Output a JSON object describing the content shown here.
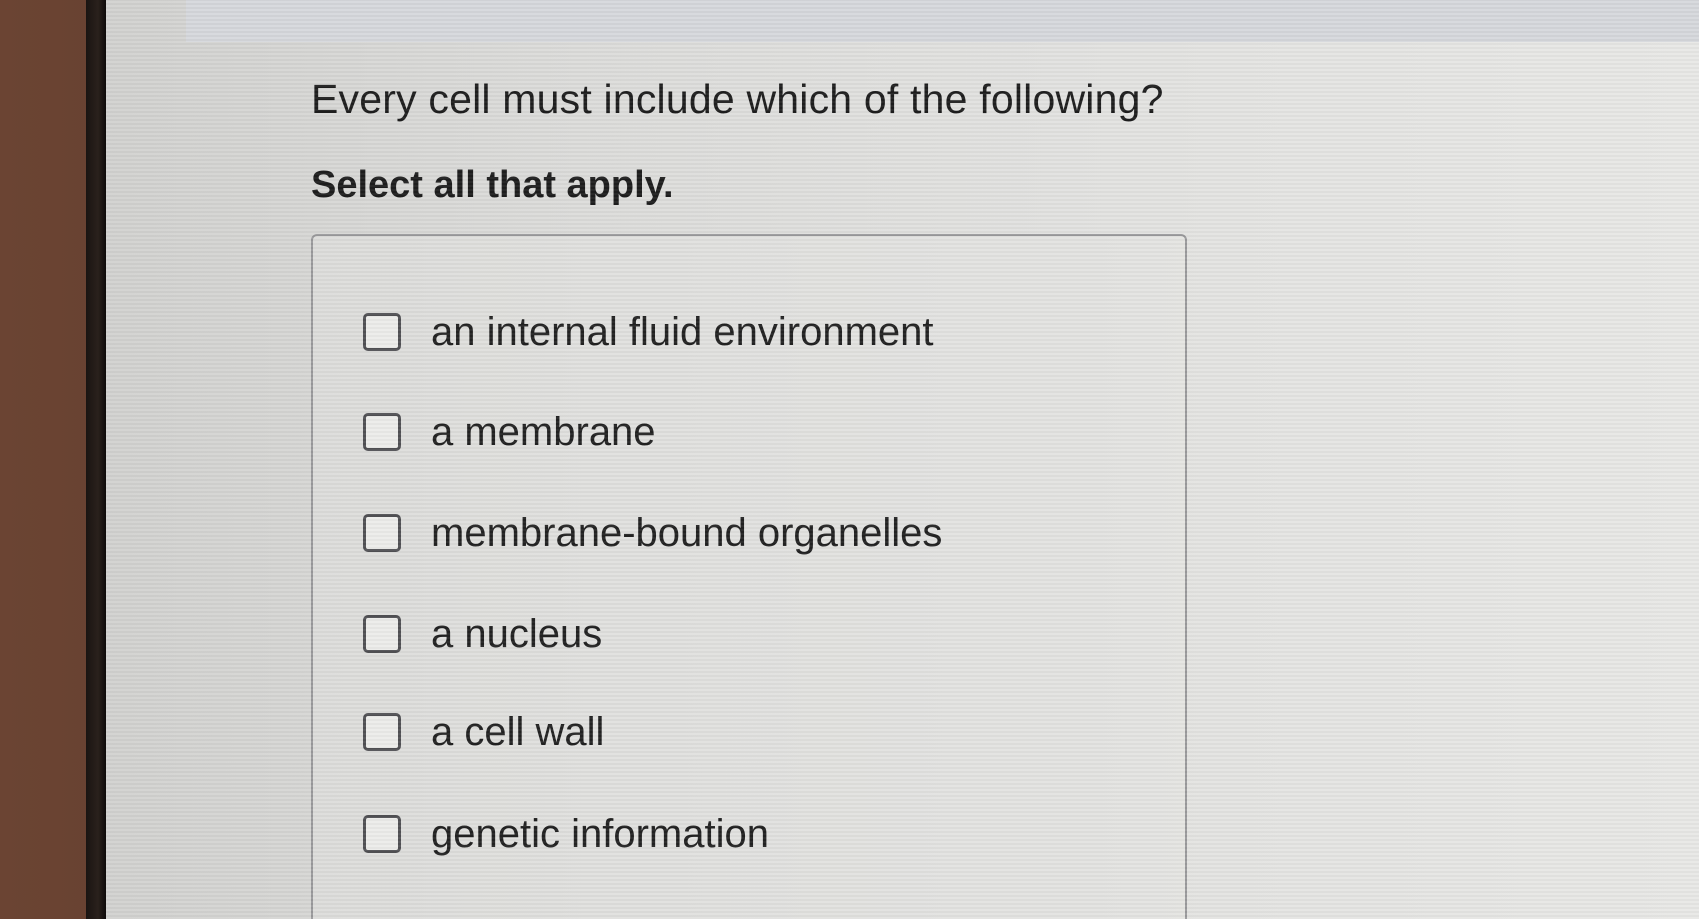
{
  "question": {
    "text": "Every cell must include which of the following?",
    "instruction": "Select all that apply."
  },
  "options": [
    {
      "label": "an internal fluid environment",
      "checked": false
    },
    {
      "label": "a membrane",
      "checked": false
    },
    {
      "label": "membrane-bound organelles",
      "checked": false
    },
    {
      "label": "a nucleus",
      "checked": false
    },
    {
      "label": "a cell wall",
      "checked": false
    },
    {
      "label": "genetic information",
      "checked": false
    }
  ]
}
